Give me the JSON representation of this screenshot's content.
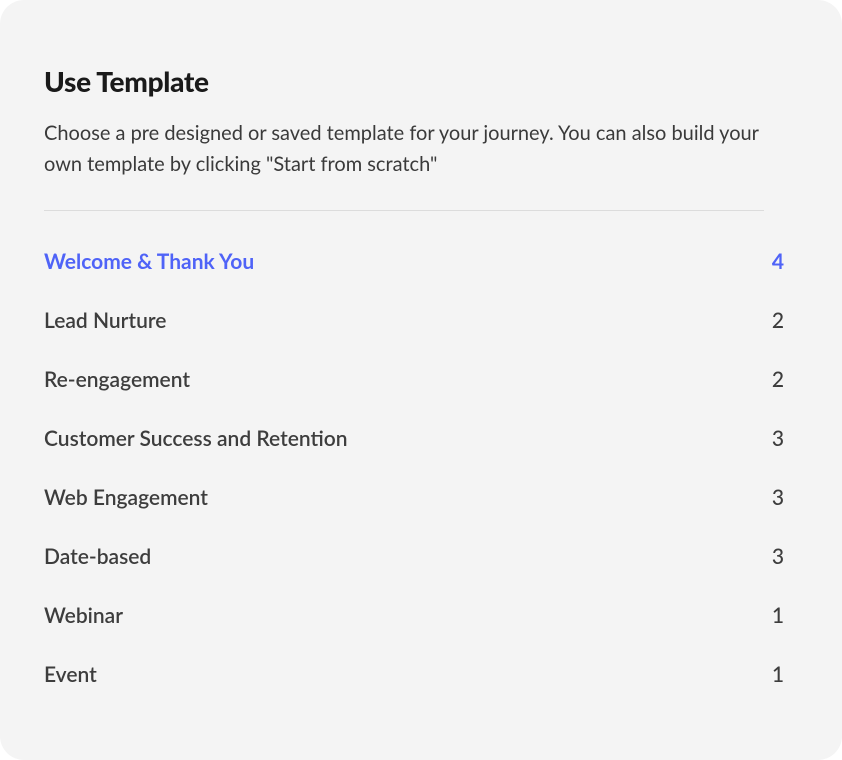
{
  "header": {
    "title": "Use Template",
    "description": "Choose a pre designed or saved template for your journey. You can also build your own template by clicking \"Start from scratch\""
  },
  "categories": [
    {
      "label": "Welcome & Thank You",
      "count": 4,
      "active": true
    },
    {
      "label": "Lead Nurture",
      "count": 2,
      "active": false
    },
    {
      "label": "Re-engagement",
      "count": 2,
      "active": false
    },
    {
      "label": "Customer Success and Retention",
      "count": 3,
      "active": false
    },
    {
      "label": "Web Engagement",
      "count": 3,
      "active": false
    },
    {
      "label": "Date-based",
      "count": 3,
      "active": false
    },
    {
      "label": "Webinar",
      "count": 1,
      "active": false
    },
    {
      "label": "Event",
      "count": 1,
      "active": false
    }
  ]
}
